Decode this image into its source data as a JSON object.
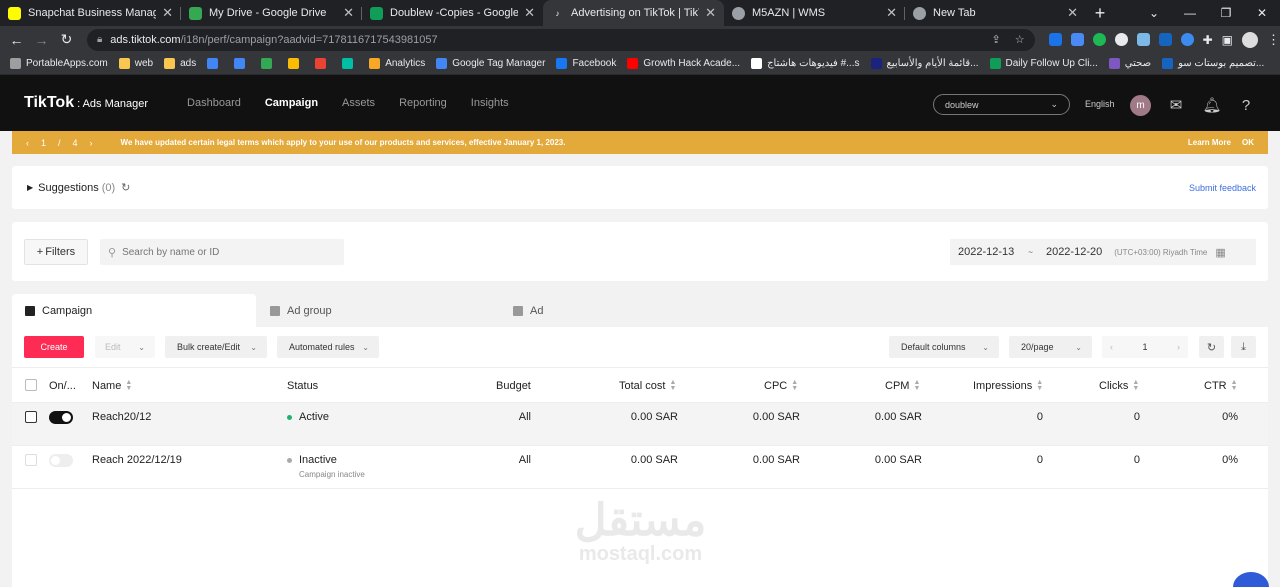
{
  "browser": {
    "tabs": [
      {
        "title": "Snapchat Business Manager",
        "color": "#fffc00"
      },
      {
        "title": "My Drive - Google Drive",
        "color": "#34a853"
      },
      {
        "title": "Doublew -Copies - Google Shee",
        "color": "#0f9d58"
      },
      {
        "title": "Advertising on TikTok | TikTok A",
        "color": "#35363a"
      },
      {
        "title": "M5AZN | WMS",
        "color": "#9aa0a6"
      },
      {
        "title": "New Tab",
        "color": "#9aa0a6"
      }
    ],
    "url_host": "ads.tiktok.com",
    "url_rest": "/i18n/perf/campaign?aadvid=7178116717543981057",
    "bookmarks": [
      {
        "label": "PortableApps.com",
        "color": "#9e9e9e"
      },
      {
        "label": "web",
        "color": "#f9c74f"
      },
      {
        "label": "ads",
        "color": "#f9c74f"
      },
      {
        "label": "",
        "color": "#4285f4"
      },
      {
        "label": "",
        "color": "#4285f4"
      },
      {
        "label": "",
        "color": "#34a853"
      },
      {
        "label": "",
        "color": "#fbbc05"
      },
      {
        "label": "",
        "color": "#ea4335"
      },
      {
        "label": "",
        "color": "#00bfa5"
      },
      {
        "label": "Analytics",
        "color": "#f9a825"
      },
      {
        "label": "Google Tag Manager",
        "color": "#4285f4"
      },
      {
        "label": "Facebook",
        "color": "#1877f2"
      },
      {
        "label": "Growth Hack Acade...",
        "color": "#ff0000"
      },
      {
        "label": "فيديوهات هاشتاج #...s",
        "color": "#ffffff"
      },
      {
        "label": "قائمة الأيام والأسابيع...",
        "color": "#1a237e"
      },
      {
        "label": "Daily Follow Up Cli...",
        "color": "#0f9d58"
      },
      {
        "label": "صحتي",
        "color": "#7e57c2"
      },
      {
        "label": "تصميم بوستات سو...",
        "color": "#1565c0"
      }
    ]
  },
  "header": {
    "logo": "TikTok",
    "logo_sub": ": Ads Manager",
    "nav": [
      "Dashboard",
      "Campaign",
      "Assets",
      "Reporting",
      "Insights"
    ],
    "active_nav": 1,
    "account": "doublew",
    "language": "English",
    "avatar_initial": "m"
  },
  "notice": {
    "page_current": "1",
    "page_sep": "/",
    "page_total": "4",
    "message": "We have updated certain legal terms which apply to your use of our products and services, effective January 1, 2023.",
    "learn_more": "Learn More",
    "ok": "OK"
  },
  "suggestions": {
    "label": "Suggestions",
    "count": "(0)",
    "feedback": "Submit feedback"
  },
  "filters": {
    "filters_label": "Filters",
    "search_placeholder": "Search by name or ID",
    "date_start": "2022-12-13",
    "date_sep": "~",
    "date_end": "2022-12-20",
    "timezone": "(UTC+03:00) Riyadh Time"
  },
  "level_tabs": [
    "Campaign",
    "Ad group",
    "Ad"
  ],
  "toolbar": {
    "create": "Create",
    "edit": "Edit",
    "bulk": "Bulk create/Edit",
    "rules": "Automated rules",
    "columns": "Default columns",
    "per_page": "20/page",
    "page": "1"
  },
  "table": {
    "headers": {
      "onoff": "On/...",
      "name": "Name",
      "status": "Status",
      "budget": "Budget",
      "cost": "Total cost",
      "cpc": "CPC",
      "cpm": "CPM",
      "impressions": "Impressions",
      "clicks": "Clicks",
      "ctr": "CTR"
    },
    "rows": [
      {
        "name": "Reach20/12",
        "status": "Active",
        "status_color": "#20b36b",
        "substatus": "",
        "budget": "All",
        "cost": "0.00 SAR",
        "cpc": "0.00 SAR",
        "cpm": "0.00 SAR",
        "impressions": "0",
        "clicks": "0",
        "ctr": "0%"
      },
      {
        "name": "Reach 2022/12/19",
        "status": "Inactive",
        "status_color": "#aaaaaa",
        "substatus": "Campaign inactive",
        "budget": "All",
        "cost": "0.00 SAR",
        "cpc": "0.00 SAR",
        "cpm": "0.00 SAR",
        "impressions": "0",
        "clicks": "0",
        "ctr": "0%"
      }
    ]
  },
  "watermark": {
    "arabic": "مستقل",
    "latin": "mostaql.com"
  }
}
